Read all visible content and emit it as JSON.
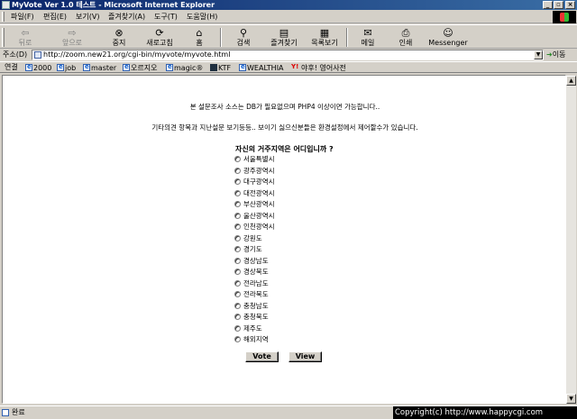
{
  "window": {
    "title": "MyVote Ver 1.0 테스트 - Microsoft Internet Explorer"
  },
  "menu": [
    "파일(F)",
    "편집(E)",
    "보기(V)",
    "즐겨찾기(A)",
    "도구(T)",
    "도움말(H)"
  ],
  "toolbar": {
    "back": "뒤로",
    "forward": "앞으로",
    "stop": "중지",
    "refresh": "새로고침",
    "home": "홈",
    "search": "검색",
    "favorites": "즐겨찾기",
    "history": "목록보기",
    "mail": "메일",
    "print": "인쇄",
    "messenger": "Messenger"
  },
  "address": {
    "label": "주소(D)",
    "url": "http://zoom.new21.org/cgi-bin/myvote/myvote.html",
    "go": "이동"
  },
  "links": {
    "label": "연결",
    "items": [
      "2000",
      "job",
      "master",
      "오르지오",
      "magic®",
      "KTF",
      "WEALTHIA",
      "야후! 영어사전"
    ]
  },
  "page": {
    "notice1": "본 설문조사 소스는 DB가 필요없으며 PHP4 이상이면 가능합니다..",
    "notice2": "기타의견 항목과 지난설문 보기등등.. 보이기 싫으신분들은 환경설정에서 제어할수가 있습니다.",
    "question": "자신의 거주지역은 어디입니까 ?",
    "options": [
      "서울특별시",
      "광주광역시",
      "대구광역시",
      "대전광역시",
      "부산광역시",
      "울산광역시",
      "인천광역시",
      "강원도",
      "경기도",
      "경상남도",
      "경상북도",
      "전라남도",
      "전라북도",
      "충청남도",
      "충청북도",
      "제주도",
      "해외지역"
    ],
    "vote_button": "Vote",
    "view_button": "View"
  },
  "status": {
    "text": "완료"
  },
  "overlay": {
    "copyright": "Copyright(c) http://www.happycgi.com"
  }
}
